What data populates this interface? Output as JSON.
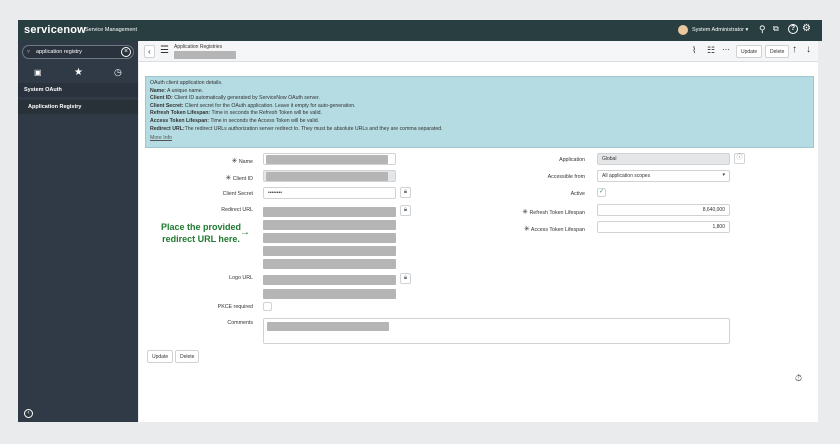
{
  "brand": {
    "logo": "servicenow",
    "product": "Service Management"
  },
  "topbar": {
    "user": "System Administrator",
    "icons": [
      "search-icon",
      "chat-icon",
      "help-icon",
      "gear-icon"
    ]
  },
  "sidebar": {
    "search_value": "application registry",
    "section": "System OAuth",
    "items": [
      {
        "label": "Application Registry"
      }
    ]
  },
  "header": {
    "breadcrumb": "Application Registries",
    "update": "Update",
    "delete": "Delete"
  },
  "info": {
    "intro": "OAuth client application details.",
    "lines": [
      {
        "k": "Name:",
        "v": " A unique name."
      },
      {
        "k": "Client ID:",
        "v": " Client ID automatically generated by ServiceNow OAuth server."
      },
      {
        "k": "Client Secret:",
        "v": " Client secret for the OAuth application. Leave it empty for auto-generation."
      },
      {
        "k": "Refresh Token Lifespan:",
        "v": " Time in seconds the Refresh Token will be valid."
      },
      {
        "k": "Access Token Lifespan:",
        "v": " Time in seconds the Access Token will be valid."
      },
      {
        "k": "Redirect URL:",
        "v": "The redirect URLs authorization server redirect to. They must be absolute URLs and they are comma separated."
      }
    ],
    "more": "More Info"
  },
  "form": {
    "name": "Name",
    "client_id": "Client ID",
    "client_secret": "Client Secret",
    "client_secret_value": "••••••••",
    "redirect_url": "Redirect URL",
    "logo_url": "Logo URL",
    "pkce": "PKCE required",
    "comments": "Comments",
    "application": "Application",
    "application_value": "Global",
    "accessible_from": "Accessible from",
    "accessible_value": "All application scopes",
    "active": "Active",
    "refresh": "Refresh Token Lifespan",
    "refresh_value": "8,640,000",
    "access": "Access Token Lifespan",
    "access_value": "1,800"
  },
  "annotation": {
    "line1": "Place the provided",
    "line2": "redirect URL here.",
    "color": "#1e7a2e"
  },
  "footer": {
    "update": "Update",
    "delete": "Delete"
  }
}
